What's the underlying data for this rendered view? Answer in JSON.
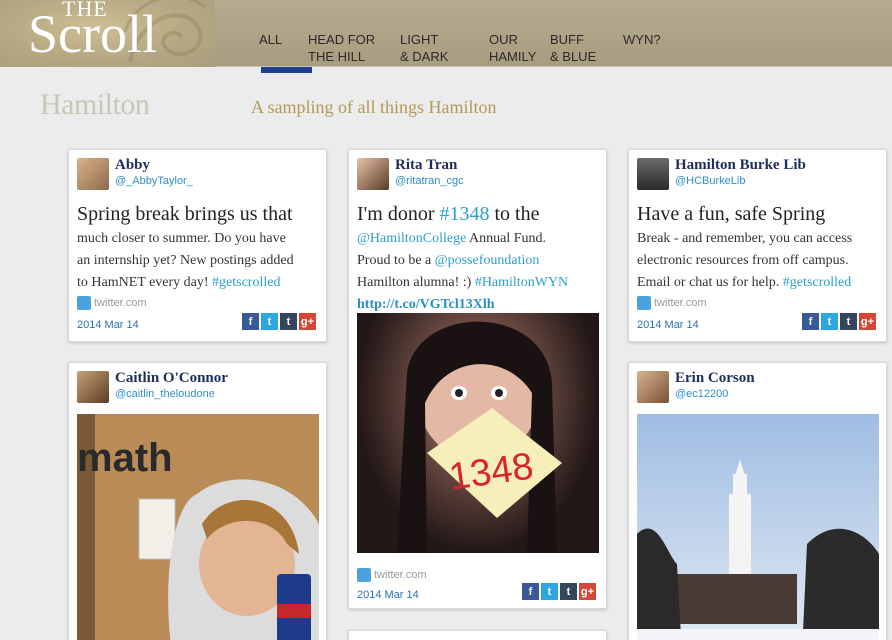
{
  "header": {
    "logo_the": "THE",
    "logo_scroll": "Scroll",
    "nav": [
      {
        "line1": "ALL",
        "line2": ""
      },
      {
        "line1": "HEAD FOR",
        "line2": "THE HILL"
      },
      {
        "line1": "LIGHT",
        "line2": "& DARK"
      },
      {
        "line1": "OUR",
        "line2": "HAMILY"
      },
      {
        "line1": "BUFF",
        "line2": "& BLUE"
      },
      {
        "line1": "WYN?",
        "line2": ""
      }
    ],
    "active_tab": "ALL",
    "accent": "#1e3f8f"
  },
  "subheader": {
    "wordmark": "Hamilton",
    "tagline": "A sampling of all things Hamilton"
  },
  "cards": {
    "abby": {
      "name": "Abby",
      "handle": "@_AbbyTaylor_",
      "lead": "Spring break brings us that",
      "t1": "much closer to summer. Do you have",
      "t2": "an internship yet? New postings added",
      "t3": "to HamNET every day! ",
      "tag": "#getscrolled",
      "source": "twitter.com",
      "date": "2014 Mar 14"
    },
    "rita": {
      "name": "Rita Tran",
      "handle": "@ritatran_cgc",
      "lead_a": "I'm donor ",
      "lead_tag": "#1348",
      "lead_b": " to the",
      "mention1": "@HamiltonCollege",
      "t1": " Annual Fund.",
      "t2": "Proud to be a ",
      "mention2": "@possefoundation",
      "t3": "Hamilton alumna! :) ",
      "tag": "#HamiltonWYN",
      "link": "http://t.co/VGTcl13Xlh",
      "photo_text": "1348",
      "source": "twitter.com",
      "date": "2014 Mar 14"
    },
    "burke": {
      "name": "Hamilton Burke Lib",
      "handle": "@HCBurkeLib",
      "lead": "Have a fun, safe Spring",
      "t1": "Break - and remember, you can access",
      "t2": "electronic resources from off campus.",
      "t3": "Email or chat us for help. ",
      "tag": "#getscrolled",
      "source": "twitter.com",
      "date": "2014 Mar 14"
    },
    "caitlin": {
      "name": "Caitlin O'Connor",
      "handle": "@caitlin_theloudone",
      "photo_text": "math"
    },
    "erin": {
      "name": "Erin Corson",
      "handle": "@ec12200"
    }
  },
  "share_icons": [
    "facebook-icon",
    "twitter-icon",
    "tumblr-icon",
    "google-plus-icon"
  ],
  "colors": {
    "facebook": "#3b5998",
    "twitter": "#2ca7e0",
    "tumblr": "#35465c",
    "gplus": "#d34836",
    "header_bg": "#b0a588",
    "tagline": "#b39a5a",
    "name": "#1e2d5a",
    "hashtag": "#2aa0d0"
  }
}
